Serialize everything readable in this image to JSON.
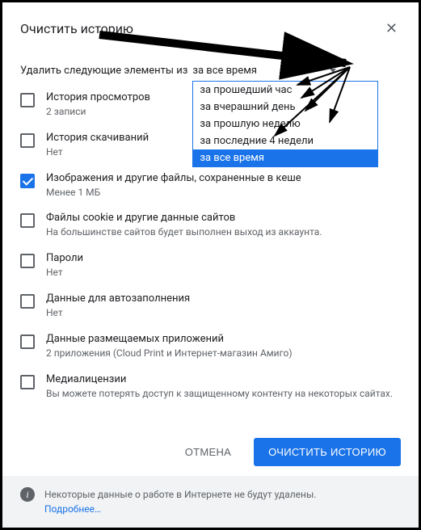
{
  "dialog": {
    "title": "Очистить историю",
    "subhead": "Удалить следующие элементы из",
    "dropdown": {
      "selected": "за все время",
      "options": [
        "за прошедший час",
        "за вчерашний день",
        "за прошлую неделю",
        "за последние 4 недели",
        "за все время"
      ]
    },
    "items": [
      {
        "title": "История просмотров",
        "desc": "2 записи",
        "checked": false
      },
      {
        "title": "История скачиваний",
        "desc": "Нет",
        "checked": false
      },
      {
        "title": "Изображения и другие файлы, сохраненные в кеше",
        "desc": "Менее 1 МБ",
        "checked": true
      },
      {
        "title": "Файлы cookie и другие данные сайтов",
        "desc": "На большинстве сайтов будет выполнен выход из аккаунта.",
        "checked": false
      },
      {
        "title": "Пароли",
        "desc": "Нет",
        "checked": false
      },
      {
        "title": "Данные для автозаполнения",
        "desc": "Нет",
        "checked": false
      },
      {
        "title": "Данные размещаемых приложений",
        "desc": "2 приложения (Cloud Print и Интернет-магазин Амиго)",
        "checked": false
      },
      {
        "title": "Медиалицензии",
        "desc": "Вы можете потерять доступ к защищенному контенту на некоторых сайтах.",
        "checked": false
      }
    ],
    "actions": {
      "cancel": "ОТМЕНА",
      "confirm": "ОЧИСТИТЬ ИСТОРИЮ"
    },
    "footer": {
      "text": "Некоторые данные о работе в Интернете не будут удалены.",
      "link": "Подробнее…"
    }
  }
}
